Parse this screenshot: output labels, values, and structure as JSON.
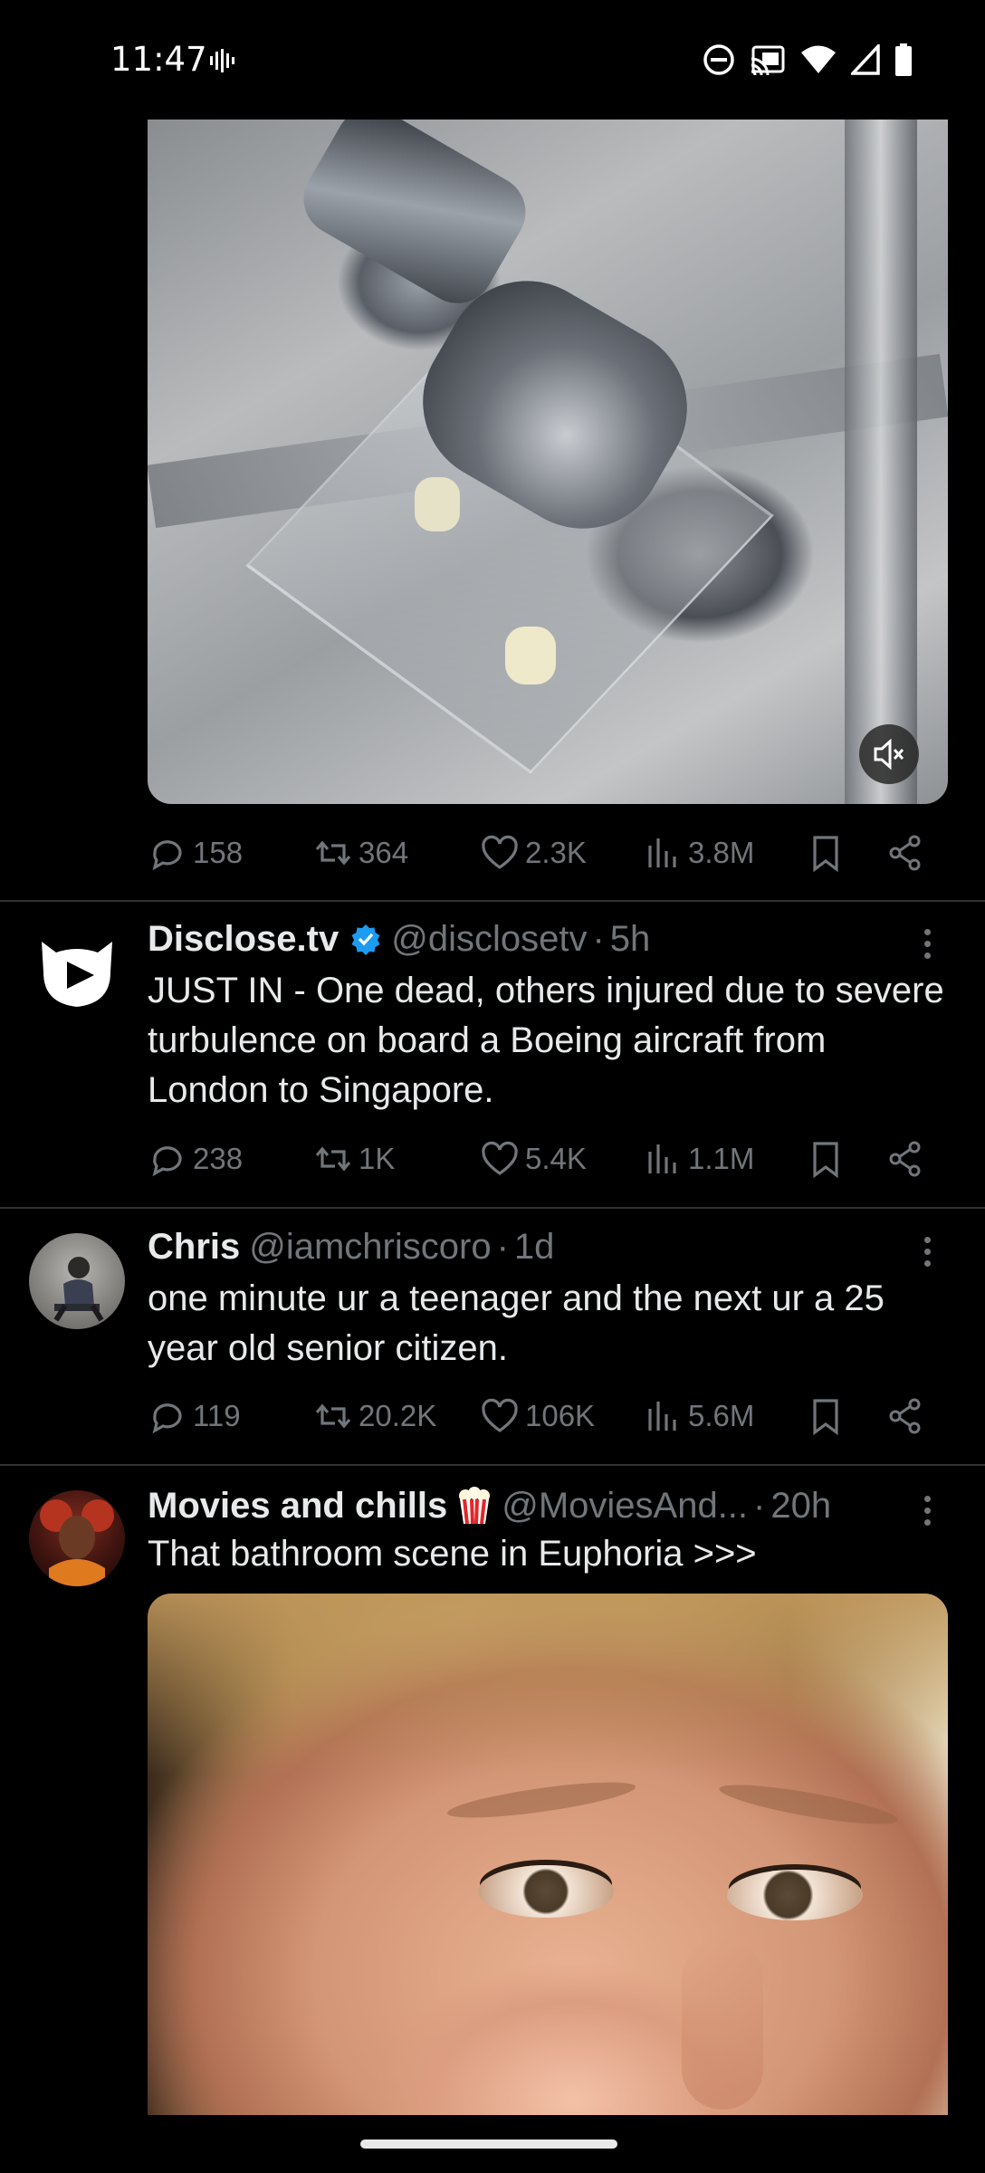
{
  "status_bar": {
    "time": "11:47",
    "icons": [
      "voicemail-icon",
      "dnd-icon",
      "cast-icon",
      "wifi-icon",
      "signal-icon",
      "battery-icon"
    ]
  },
  "colors": {
    "background": "#000000",
    "text_primary": "#e7e9ea",
    "text_secondary": "#71767b",
    "verified_blue": "#1d9bf0",
    "divider": "#2f3336"
  },
  "tweets": [
    {
      "media": {
        "type": "video",
        "muted_icon": "volume-mute-icon"
      },
      "stats": {
        "replies": "158",
        "reposts": "364",
        "likes": "2.3K",
        "views": "3.8M"
      }
    },
    {
      "name": "Disclose.tv",
      "verified": true,
      "handle": "@disclosetv",
      "separator": "·",
      "time": "5h",
      "text": "JUST IN - One dead, others injured due to severe turbulence on board a Boeing aircraft from London to Singapore.",
      "stats": {
        "replies": "238",
        "reposts": "1K",
        "likes": "5.4K",
        "views": "1.1M"
      }
    },
    {
      "name": "Chris",
      "handle": "@iamchriscoro",
      "separator": "·",
      "time": "1d",
      "text": "one minute ur a teenager and the next ur a 25 year old senior citizen.",
      "stats": {
        "replies": "119",
        "reposts": "20.2K",
        "likes": "106K",
        "views": "5.6M"
      }
    },
    {
      "name": "Movies and chills",
      "name_emoji": "popcorn-icon",
      "handle": "@MoviesAnd...",
      "separator": "·",
      "time": "20h",
      "text": "That bathroom scene in Euphoria >>>",
      "media": {
        "type": "image"
      }
    }
  ]
}
